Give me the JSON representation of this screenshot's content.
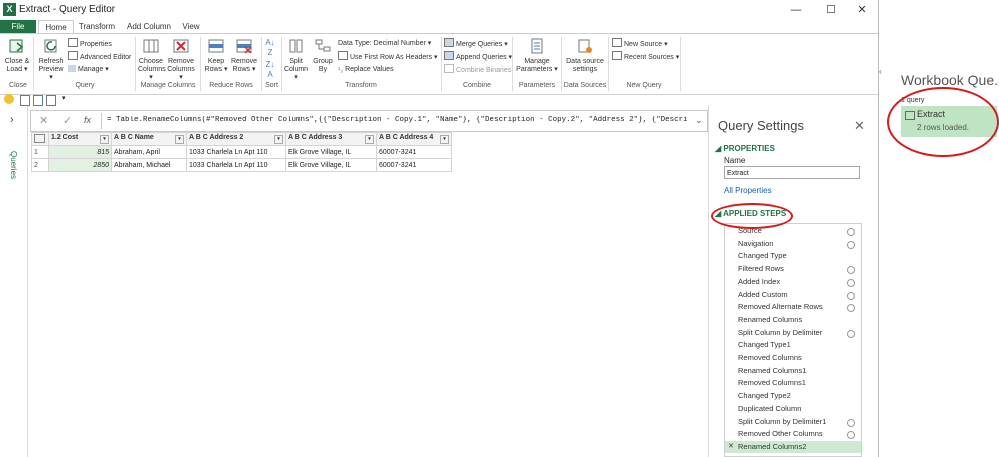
{
  "window": {
    "title": "Extract - Query Editor",
    "min": "—",
    "max": "☐",
    "close": "✕"
  },
  "tabs": [
    "File",
    "Home",
    "Transform",
    "Add Column",
    "View"
  ],
  "ribbon": {
    "close_load": "Close & Load ▾",
    "refresh_preview": "Refresh Preview ▾",
    "properties": "Properties",
    "advanced_editor": "Advanced Editor",
    "manage": "Manage ▾",
    "choose_columns": "Choose Columns ▾",
    "remove_columns": "Remove Columns ▾",
    "keep_rows": "Keep Rows ▾",
    "remove_rows": "Remove Rows ▾",
    "split_column": "Split Column ▾",
    "group_by": "Group By",
    "data_type": "Data Type: Decimal Number ▾",
    "first_row_headers": "Use First Row As Headers ▾",
    "replace_values": "Replace Values",
    "merge_queries": "Merge Queries ▾",
    "append_queries": "Append Queries ▾",
    "combine_binaries": "Combine Binaries",
    "manage_parameters": "Manage Parameters ▾",
    "data_source_settings": "Data source settings",
    "new_source": "New Source ▾",
    "recent_sources": "Recent Sources ▾",
    "groups": {
      "close": "Close",
      "query": "Query",
      "manage_columns": "Manage Columns",
      "reduce_rows": "Reduce Rows",
      "sort": "Sort",
      "transform": "Transform",
      "combine": "Combine",
      "parameters": "Parameters",
      "data_sources": "Data Sources",
      "new_query": "New Query"
    }
  },
  "nav": {
    "label": "Queries",
    "chevron": "›"
  },
  "formula": {
    "cancel": "✕",
    "commit": "✓",
    "fx": "fx",
    "text": "= Table.RenameColumns(#\"Removed Other Columns\",{{\"Description - Copy.1\", \"Name\"}, {\"Description - Copy.2\", \"Address 2\"}, {\"Description -",
    "expand": "⌄"
  },
  "grid": {
    "headers": [
      "1.2  Cost",
      "A B C  Name",
      "A B C  Address 2",
      "A B C  Address 3",
      "A B C  Address 4"
    ],
    "rows": [
      [
        "1",
        "815",
        "Abraham, April",
        "1033 Charlela Ln Apt 110",
        "Elk Grove Village, IL",
        "60007-3241"
      ],
      [
        "2",
        "2850",
        "Abraham, Michael",
        "1033 Charlela Ln Apt 110",
        "Elk Grove Village, IL",
        "60007-3241"
      ]
    ]
  },
  "query_settings": {
    "title": "Query Settings",
    "close": "✕",
    "properties_head": "◢ PROPERTIES",
    "name_label": "Name",
    "name_value": "Extract",
    "all_properties": "All Properties",
    "applied_steps_head": "◢ APPLIED STEPS",
    "steps": [
      {
        "label": "Source",
        "gear": true
      },
      {
        "label": "Navigation",
        "gear": true
      },
      {
        "label": "Changed Type",
        "gear": false
      },
      {
        "label": "Filtered Rows",
        "gear": true
      },
      {
        "label": "Added Index",
        "gear": true
      },
      {
        "label": "Added Custom",
        "gear": true
      },
      {
        "label": "Removed Alternate Rows",
        "gear": true
      },
      {
        "label": "Renamed Columns",
        "gear": false
      },
      {
        "label": "Split Column by Delimiter",
        "gear": true
      },
      {
        "label": "Changed Type1",
        "gear": false
      },
      {
        "label": "Removed Columns",
        "gear": false
      },
      {
        "label": "Renamed Columns1",
        "gear": false
      },
      {
        "label": "Removed Columns1",
        "gear": false
      },
      {
        "label": "Changed Type2",
        "gear": false
      },
      {
        "label": "Duplicated Column",
        "gear": false
      },
      {
        "label": "Split Column by Delimiter1",
        "gear": true
      },
      {
        "label": "Removed Other Columns",
        "gear": true
      },
      {
        "label": "Renamed Columns2",
        "gear": false,
        "selected": true
      }
    ]
  },
  "workbook_queries": {
    "title": "Workbook Que..",
    "count": "1 query",
    "query_name": "Extract",
    "status": "2 rows loaded."
  },
  "colors": {
    "brand": "#217346",
    "selected_step": "#cfe8d0",
    "query_card": "#bfe4c4",
    "annotation": "#d61a1a"
  }
}
